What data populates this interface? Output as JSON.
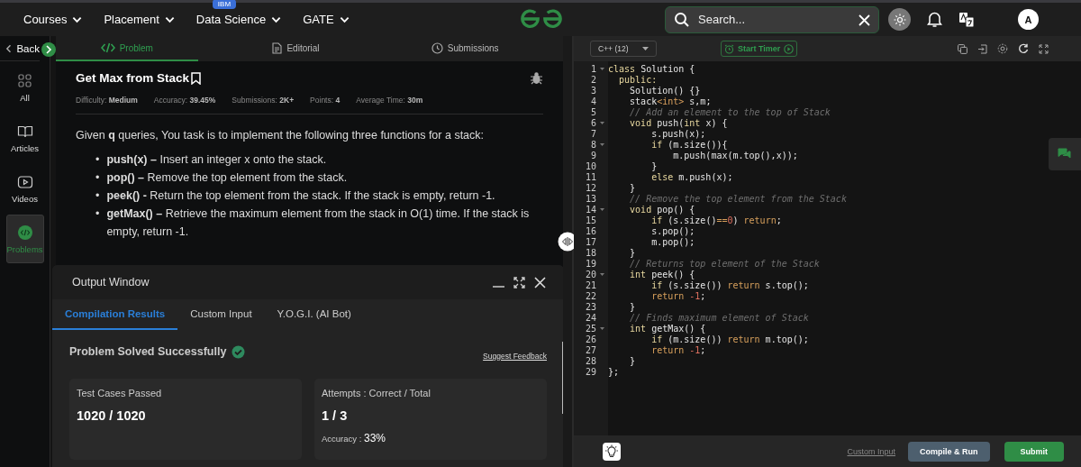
{
  "nav": {
    "items": [
      {
        "label": "Courses"
      },
      {
        "label": "Placement"
      },
      {
        "label": "Data Science",
        "badge": "IBM"
      },
      {
        "label": "GATE"
      }
    ],
    "search": {
      "placeholder": "Search..."
    },
    "avatar": "A"
  },
  "sidebar": {
    "back": "Back",
    "items": [
      {
        "label": "All",
        "selected": false
      },
      {
        "label": "Articles",
        "selected": false
      },
      {
        "label": "Videos",
        "selected": false
      },
      {
        "label": "Problems",
        "selected": true
      }
    ]
  },
  "problem": {
    "tabs": [
      {
        "label": "Problem",
        "selected": true
      },
      {
        "label": "Editorial",
        "selected": false
      },
      {
        "label": "Submissions",
        "selected": false
      }
    ],
    "title": "Get Max from Stack",
    "meta": [
      "Difficulty: **Medium**",
      "Accuracy: **39.45%**",
      "Submissions: **2K+**",
      "Points: **4**",
      "Average Time: **30m**"
    ],
    "intro": "Given **q** queries, You task is to implement the following three functions for a stack:",
    "bullets": [
      {
        "marker": "•",
        "text": "**push(x) –** Insert an integer x onto the stack."
      },
      {
        "marker": "•",
        "text": "**pop() –** Remove the top element from the stack."
      },
      {
        "marker": "•",
        "text": "**peek() -** Return the top element from the stack. If the stack is empty, return -1."
      },
      {
        "marker": "•",
        "text": "**getMax() –** Retrieve the maximum element from the stack in O(1) time. If the stack is empty, return -1."
      }
    ]
  },
  "output": {
    "title": "Output Window",
    "tabs": [
      {
        "label": "Compilation Results",
        "selected": true
      },
      {
        "label": "Custom Input",
        "selected": false
      },
      {
        "label": "Y.O.G.I. (AI Bot)",
        "selected": false
      }
    ],
    "status": "Problem Solved Successfully",
    "feedback": "Suggest Feedback",
    "cards": [
      {
        "label": "Test Cases Passed",
        "value": "1020 / 1020"
      },
      {
        "label": "Attempts : Correct / Total",
        "value": "1 / 3",
        "extra_label": "Accuracy :",
        "extra_value": "33%"
      }
    ]
  },
  "editor": {
    "language": "C++ (12)",
    "timer": "Start Timer",
    "lines": [
      {
        "n": "1",
        "fold": true,
        "tokens": [
          {
            "kind": "keyword",
            "text": "class"
          },
          {
            "kind": "plain",
            "text": " Solution {"
          }
        ]
      },
      {
        "n": "2",
        "fold": false,
        "tokens": [
          {
            "kind": "keyword",
            "text": "  public:"
          }
        ]
      },
      {
        "n": "3",
        "fold": false,
        "tokens": [
          {
            "kind": "plain",
            "text": "    Solution() {}"
          }
        ]
      },
      {
        "n": "4",
        "fold": false,
        "tokens": [
          {
            "kind": "plain",
            "text": "    stack"
          },
          {
            "kind": "template",
            "text": "<int>"
          },
          {
            "kind": "plain",
            "text": " s,m;"
          }
        ]
      },
      {
        "n": "5",
        "fold": false,
        "tokens": [
          {
            "kind": "comment",
            "text": "    // Add an element to the top of Stack"
          }
        ]
      },
      {
        "n": "6",
        "fold": true,
        "tokens": [
          {
            "kind": "keyword",
            "text": "    void"
          },
          {
            "kind": "plain",
            "text": " push("
          },
          {
            "kind": "keyword",
            "text": "int"
          },
          {
            "kind": "plain",
            "text": " x) {"
          }
        ]
      },
      {
        "n": "7",
        "fold": false,
        "tokens": [
          {
            "kind": "plain",
            "text": "        s.push(x);"
          }
        ]
      },
      {
        "n": "8",
        "fold": true,
        "tokens": [
          {
            "kind": "keyword",
            "text": "        if"
          },
          {
            "kind": "plain",
            "text": " (m.size()){"
          }
        ]
      },
      {
        "n": "9",
        "fold": false,
        "tokens": [
          {
            "kind": "plain",
            "text": "            m.push(max(m.top(),x));"
          }
        ]
      },
      {
        "n": "10",
        "fold": false,
        "tokens": [
          {
            "kind": "plain",
            "text": "        }"
          }
        ]
      },
      {
        "n": "11",
        "fold": false,
        "tokens": [
          {
            "kind": "keyword",
            "text": "        else"
          },
          {
            "kind": "plain",
            "text": " m.push(x);"
          }
        ]
      },
      {
        "n": "12",
        "fold": false,
        "tokens": [
          {
            "kind": "plain",
            "text": "    }"
          }
        ]
      },
      {
        "n": "13",
        "fold": false,
        "tokens": [
          {
            "kind": "comment",
            "text": "    // Remove the top element from the Stack"
          }
        ]
      },
      {
        "n": "14",
        "fold": true,
        "tokens": [
          {
            "kind": "keyword",
            "text": "    void"
          },
          {
            "kind": "plain",
            "text": " pop() {"
          }
        ]
      },
      {
        "n": "15",
        "fold": false,
        "tokens": [
          {
            "kind": "keyword",
            "text": "        if"
          },
          {
            "kind": "plain",
            "text": " (s.size()"
          },
          {
            "kind": "return",
            "text": "=="
          },
          {
            "kind": "number",
            "text": "0"
          },
          {
            "kind": "plain",
            "text": ") "
          },
          {
            "kind": "return",
            "text": "return"
          },
          {
            "kind": "plain",
            "text": ";"
          }
        ]
      },
      {
        "n": "16",
        "fold": false,
        "tokens": [
          {
            "kind": "plain",
            "text": "        s.pop();"
          }
        ]
      },
      {
        "n": "17",
        "fold": false,
        "tokens": [
          {
            "kind": "plain",
            "text": "        m.pop();"
          }
        ]
      },
      {
        "n": "18",
        "fold": false,
        "tokens": [
          {
            "kind": "plain",
            "text": "    }"
          }
        ]
      },
      {
        "n": "19",
        "fold": false,
        "tokens": [
          {
            "kind": "comment",
            "text": "    // Returns top element of the Stack"
          }
        ]
      },
      {
        "n": "20",
        "fold": true,
        "tokens": [
          {
            "kind": "keyword",
            "text": "    int"
          },
          {
            "kind": "plain",
            "text": " peek() {"
          }
        ]
      },
      {
        "n": "21",
        "fold": false,
        "tokens": [
          {
            "kind": "keyword",
            "text": "        if"
          },
          {
            "kind": "plain",
            "text": " (s.size()) "
          },
          {
            "kind": "return",
            "text": "return"
          },
          {
            "kind": "plain",
            "text": " s.top();"
          }
        ]
      },
      {
        "n": "22",
        "fold": false,
        "tokens": [
          {
            "kind": "return",
            "text": "        return"
          },
          {
            "kind": "number",
            "text": " -1"
          },
          {
            "kind": "plain",
            "text": ";"
          }
        ]
      },
      {
        "n": "23",
        "fold": false,
        "tokens": [
          {
            "kind": "plain",
            "text": "    }"
          }
        ]
      },
      {
        "n": "24",
        "fold": false,
        "tokens": [
          {
            "kind": "comment",
            "text": "    // Finds maximum element of Stack"
          }
        ]
      },
      {
        "n": "25",
        "fold": true,
        "tokens": [
          {
            "kind": "keyword",
            "text": "    int"
          },
          {
            "kind": "plain",
            "text": " getMax() {"
          }
        ]
      },
      {
        "n": "26",
        "fold": false,
        "tokens": [
          {
            "kind": "keyword",
            "text": "        if"
          },
          {
            "kind": "plain",
            "text": " (m.size()) "
          },
          {
            "kind": "return",
            "text": "return"
          },
          {
            "kind": "plain",
            "text": " m.top();"
          }
        ]
      },
      {
        "n": "27",
        "fold": false,
        "tokens": [
          {
            "kind": "return",
            "text": "        return"
          },
          {
            "kind": "number",
            "text": " -1"
          },
          {
            "kind": "plain",
            "text": ";"
          }
        ]
      },
      {
        "n": "28",
        "fold": false,
        "tokens": [
          {
            "kind": "plain",
            "text": "    }"
          }
        ]
      },
      {
        "n": "29",
        "fold": false,
        "tokens": [
          {
            "kind": "plain",
            "text": "};"
          }
        ]
      }
    ],
    "custom_input": "Custom Input",
    "compile": "Compile & Run",
    "submit": "Submit"
  }
}
